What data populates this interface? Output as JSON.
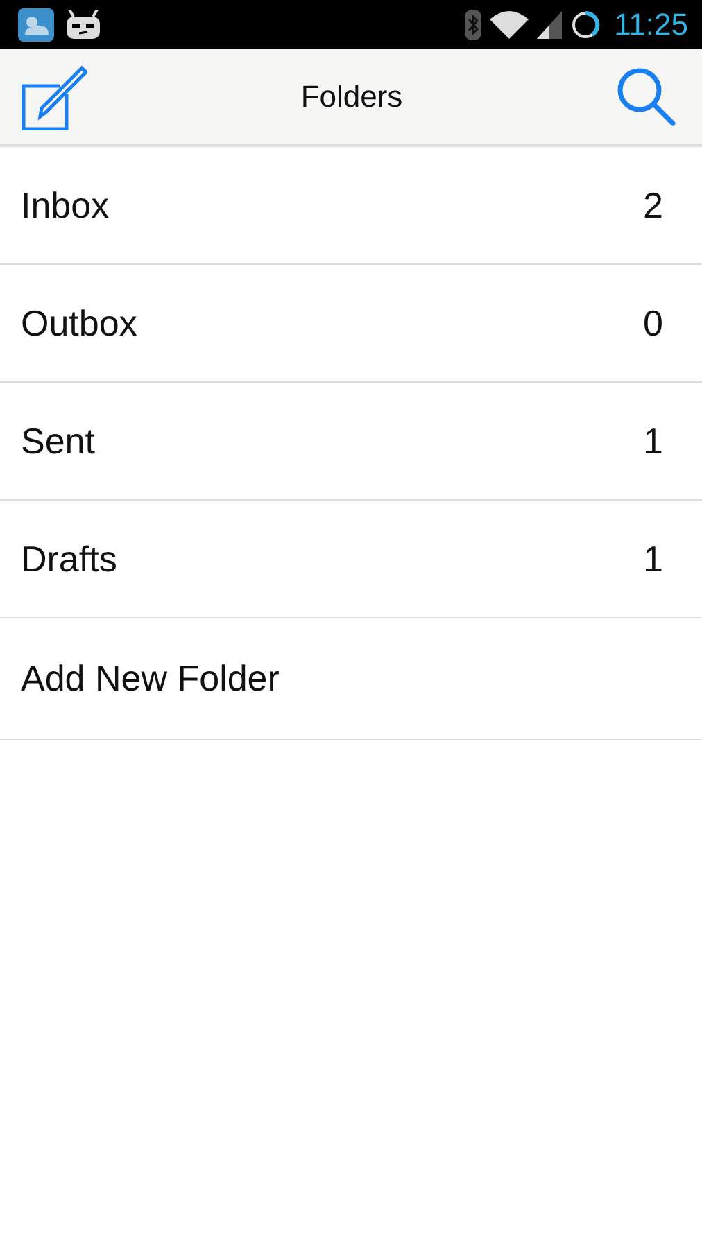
{
  "status_bar": {
    "time": "11:25"
  },
  "header": {
    "title": "Folders"
  },
  "folders": [
    {
      "name": "Inbox",
      "count": "2"
    },
    {
      "name": "Outbox",
      "count": "0"
    },
    {
      "name": "Sent",
      "count": "1"
    },
    {
      "name": "Drafts",
      "count": "1"
    },
    {
      "name": "Add New Folder"
    }
  ]
}
